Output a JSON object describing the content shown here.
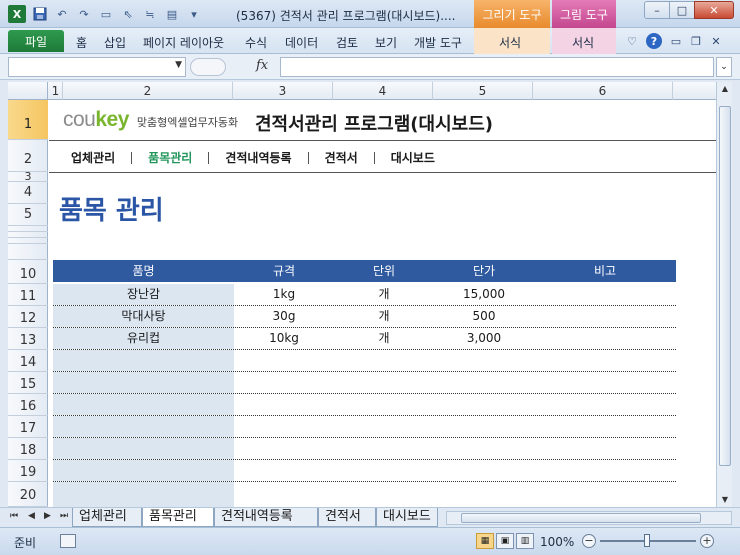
{
  "window": {
    "title": "(5367) 견적서 관리 프로그램(대시보드)....",
    "context_tabs": [
      "그리기 도구",
      "그림 도구"
    ],
    "controls": {
      "minimize": "–",
      "maximize": "□",
      "close": "✕"
    }
  },
  "quick_access": {
    "icons": [
      "excel-logo",
      "save-icon",
      "undo-icon",
      "redo-icon",
      "select-icon",
      "chart-icon",
      "form-icon",
      "customize-icon"
    ]
  },
  "ribbon": {
    "file": "파일",
    "tabs": [
      "홈",
      "삽입",
      "페이지 레이아웃",
      "수식",
      "데이터",
      "검토",
      "보기",
      "개발 도구"
    ],
    "context_subtabs": [
      "서식",
      "서식"
    ]
  },
  "formula_bar": {
    "name_box": "",
    "fx": "fx",
    "content": ""
  },
  "columns": [
    "1",
    "2",
    "3",
    "4",
    "5",
    "6"
  ],
  "rows": [
    "1",
    "2",
    "3",
    "4",
    "5",
    "",
    "",
    "",
    "",
    "10",
    "11",
    "12",
    "13",
    "14",
    "15",
    "16",
    "17",
    "18",
    "19",
    "20"
  ],
  "sheet": {
    "logo": {
      "cou": "cou",
      "key": "key",
      "tagline": "맞춤형엑셀업무자동화"
    },
    "title": "견적서관리 프로그램(대시보드)",
    "menu": [
      {
        "label": "업체관리",
        "active": false
      },
      {
        "label": "품목관리",
        "active": true
      },
      {
        "label": "견적내역등록",
        "active": false
      },
      {
        "label": "견적서",
        "active": false
      },
      {
        "label": "대시보드",
        "active": false
      }
    ],
    "heading": "품목 관리",
    "table": {
      "headers": [
        "품명",
        "규격",
        "단위",
        "단가",
        "비고"
      ],
      "rows": [
        [
          "장난감",
          "1kg",
          "개",
          "15,000",
          ""
        ],
        [
          "막대사탕",
          "30g",
          "개",
          "500",
          ""
        ],
        [
          "유리컵",
          "10kg",
          "개",
          "3,000",
          ""
        ],
        [
          "",
          "",
          "",
          "",
          ""
        ],
        [
          "",
          "",
          "",
          "",
          ""
        ],
        [
          "",
          "",
          "",
          "",
          ""
        ],
        [
          "",
          "",
          "",
          "",
          ""
        ],
        [
          "",
          "",
          "",
          "",
          ""
        ],
        [
          "",
          "",
          "",
          "",
          ""
        ],
        [
          "",
          "",
          "",
          "",
          ""
        ]
      ]
    }
  },
  "sheet_tabs": [
    {
      "label": "업체관리",
      "active": false
    },
    {
      "label": "품목관리",
      "active": true
    },
    {
      "label": "견적내역등록",
      "active": false
    },
    {
      "label": "견적서",
      "active": false
    },
    {
      "label": "대시보드",
      "active": false
    }
  ],
  "status": {
    "ready": "준비",
    "zoom": "100%"
  },
  "colors": {
    "accent_green": "#21965a",
    "table_header": "#2f5aa0",
    "heading_blue": "#2a56a5",
    "name_column_bg": "#dce6f1"
  }
}
